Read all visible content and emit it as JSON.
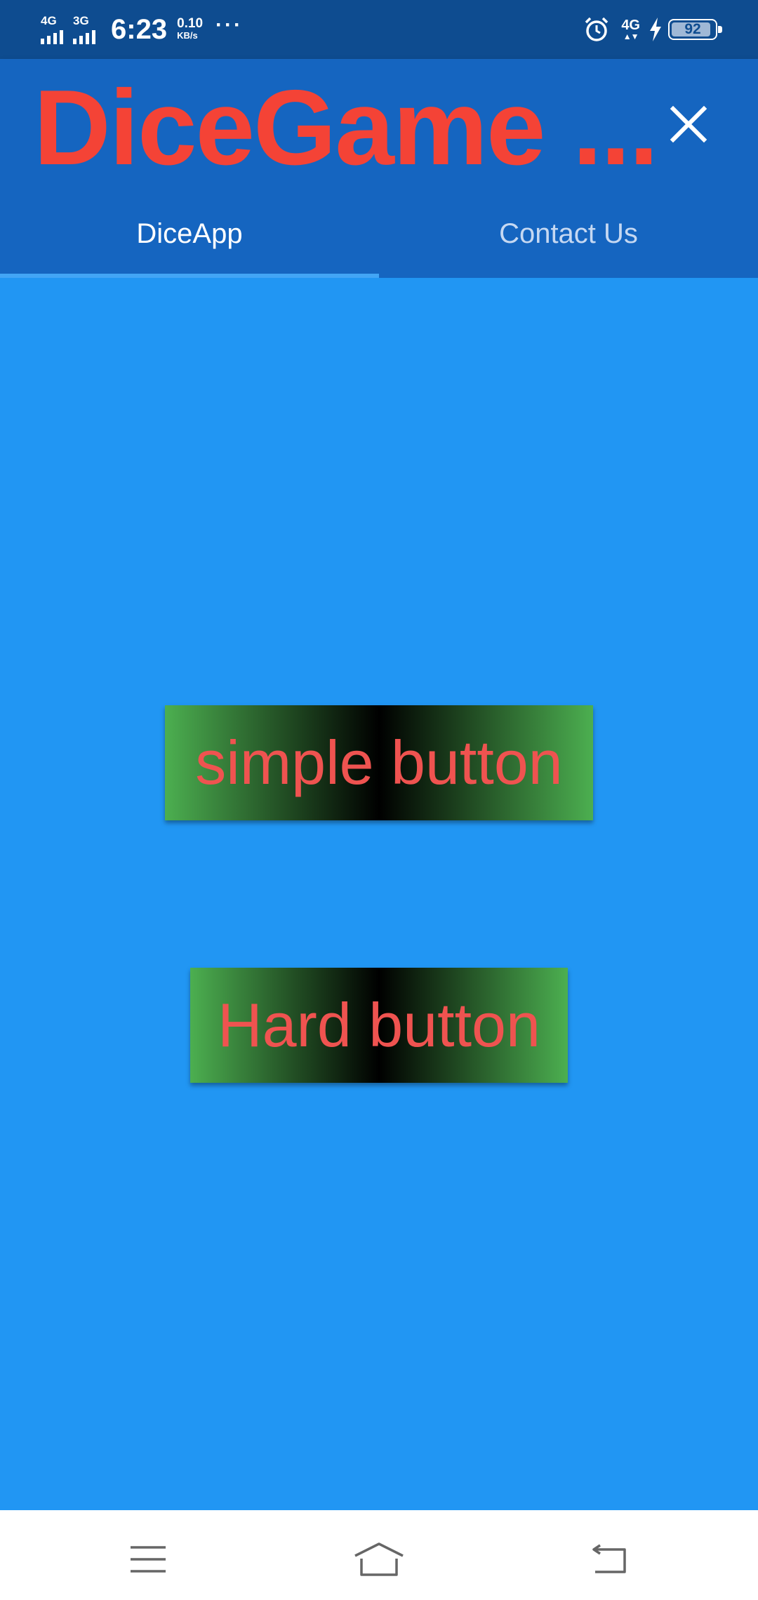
{
  "status_bar": {
    "net1": "4G",
    "net2": "3G",
    "time": "6:23",
    "speed_value": "0.10",
    "speed_unit": "KB/s",
    "more": "···",
    "net_right": "4G",
    "net_right_activity": "▲▼",
    "battery": "92",
    "icons": [
      "signal-icon",
      "alarm-icon",
      "charging-bolt-icon",
      "battery-icon"
    ]
  },
  "app_bar": {
    "title": "DiceGame ...",
    "close_icon": "close-icon",
    "title_color": "#F44336"
  },
  "tabs": [
    {
      "label": "DiceApp",
      "active": true
    },
    {
      "label": "Contact Us",
      "active": false
    }
  ],
  "main": {
    "buttons": [
      {
        "label": "simple button"
      },
      {
        "label": "Hard button"
      }
    ],
    "background": "#2196F3",
    "button_text_color": "#EF5350"
  },
  "nav_bar": {
    "icons": [
      "menu-icon",
      "home-icon",
      "back-icon"
    ]
  }
}
